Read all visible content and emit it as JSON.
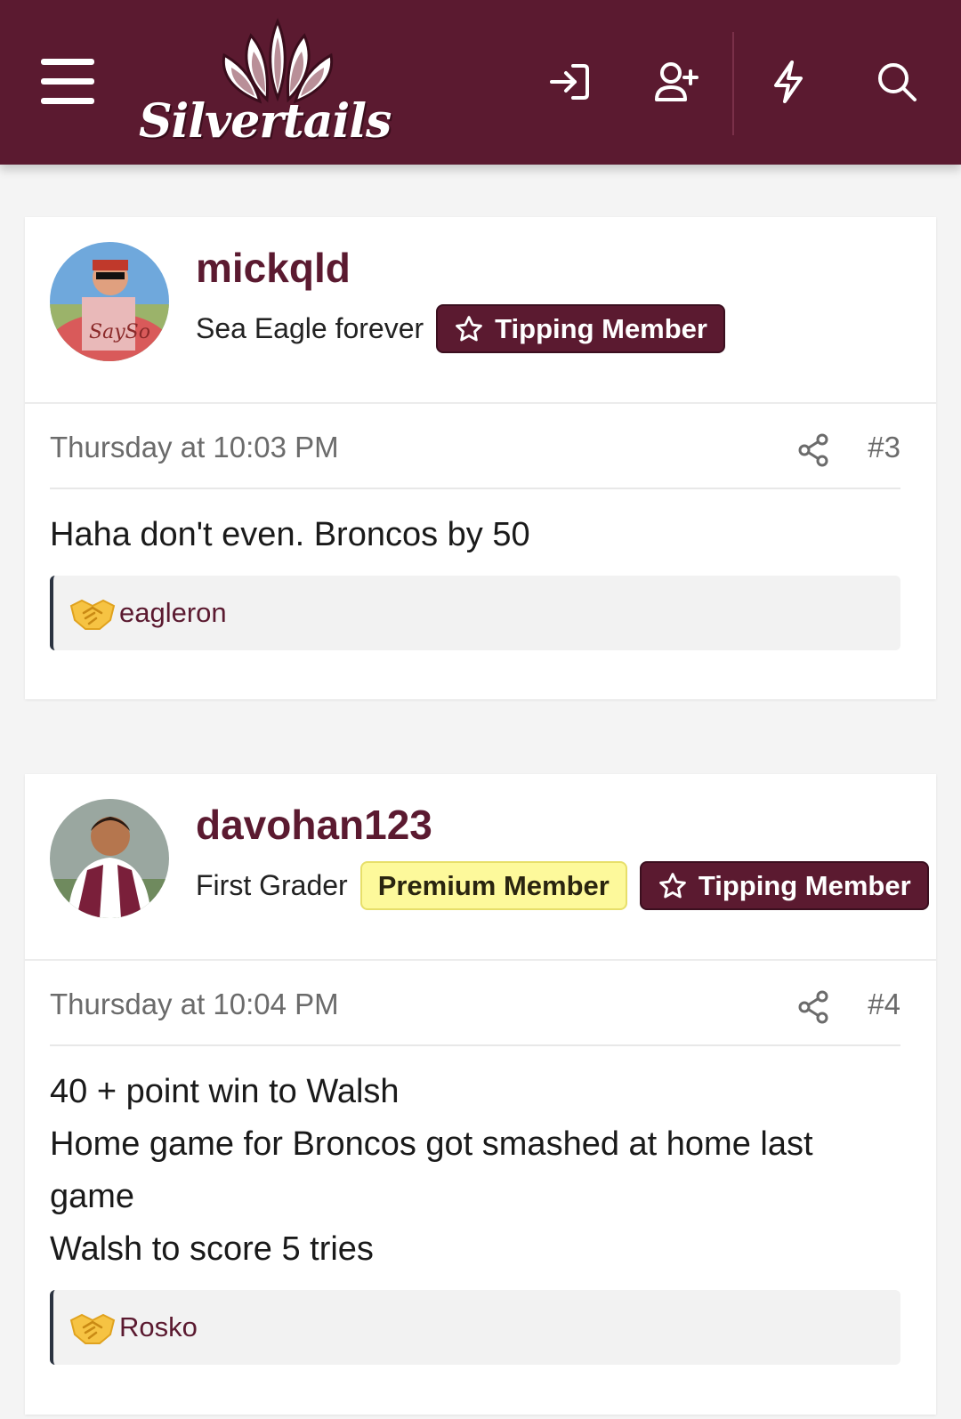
{
  "header": {
    "brand": "Silvertails",
    "icons": [
      "menu-icon",
      "login-icon",
      "register-icon",
      "whats-new-icon",
      "search-icon"
    ]
  },
  "colors": {
    "brand": "#5b1a30",
    "premium_badge": "#fdf99b",
    "background": "#f4f4f4"
  },
  "posts": [
    {
      "username": "mickqld",
      "user_title": "Sea Eagle forever",
      "badges": [
        "Tipping Member"
      ],
      "date": "Thursday at 10:03 PM",
      "post_number": "#3",
      "body": [
        "Haha don't even. Broncos by 50"
      ],
      "reaction_icon": "handshake-icon",
      "reaction_user": "eagleron"
    },
    {
      "username": "davohan123",
      "user_title": "First Grader",
      "badges": [
        "Premium Member",
        "Tipping Member"
      ],
      "date": "Thursday at 10:04 PM",
      "post_number": "#4",
      "body": [
        "40 + point win to Walsh",
        "Home game for Broncos got smashed at home last",
        "game",
        "Walsh to score 5 tries"
      ],
      "reaction_icon": "handshake-icon",
      "reaction_user": "Rosko"
    }
  ]
}
